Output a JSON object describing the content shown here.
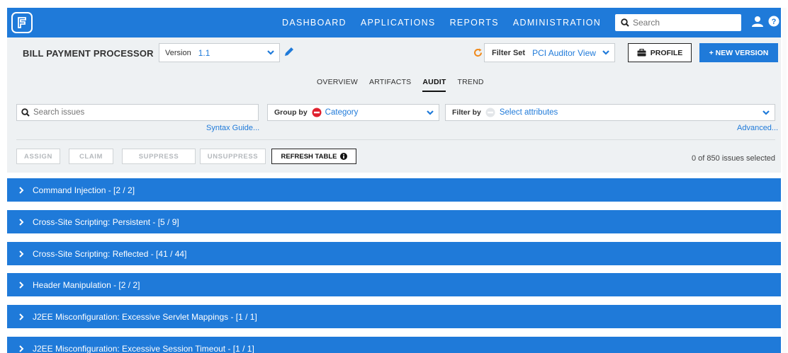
{
  "nav": {
    "items": [
      "DASHBOARD",
      "APPLICATIONS",
      "REPORTS",
      "ADMINISTRATION"
    ],
    "search_placeholder": "Search",
    "icons": [
      "logo-icon",
      "search-icon",
      "user-icon",
      "help-icon"
    ],
    "brand_color": "#1f7ad9"
  },
  "header": {
    "app_title": "BILL PAYMENT PROCESSOR",
    "version_label": "Version",
    "version_value": "1.1",
    "filterset_label": "Filter Set",
    "filterset_value": "PCI Auditor View",
    "profile_label": "PROFILE",
    "new_version_label": "+ NEW VERSION"
  },
  "tabs": [
    {
      "label": "OVERVIEW",
      "active": false
    },
    {
      "label": "ARTIFACTS",
      "active": false
    },
    {
      "label": "AUDIT",
      "active": true
    },
    {
      "label": "TREND",
      "active": false
    }
  ],
  "filters": {
    "search_placeholder": "Search issues",
    "syntax_guide": "Syntax Guide...",
    "groupby_label": "Group by",
    "groupby_value": "Category",
    "filterby_label": "Filter by",
    "filterby_value": "Select attributes",
    "advanced": "Advanced..."
  },
  "actions": {
    "assign": "ASSIGN",
    "claim": "CLAIM",
    "suppress": "SUPPRESS",
    "unsuppress": "UNSUPPRESS",
    "refresh": "REFRESH TABLE",
    "selected_count": "0 of 850 issues selected"
  },
  "categories": [
    "Command Injection - [2 / 2]",
    "Cross-Site Scripting: Persistent - [5 / 9]",
    "Cross-Site Scripting: Reflected - [41 / 44]",
    "Header Manipulation - [2 / 2]",
    "J2EE Misconfiguration: Excessive Servlet Mappings - [1 / 1]",
    "J2EE Misconfiguration: Excessive Session Timeout - [1 / 1]"
  ]
}
